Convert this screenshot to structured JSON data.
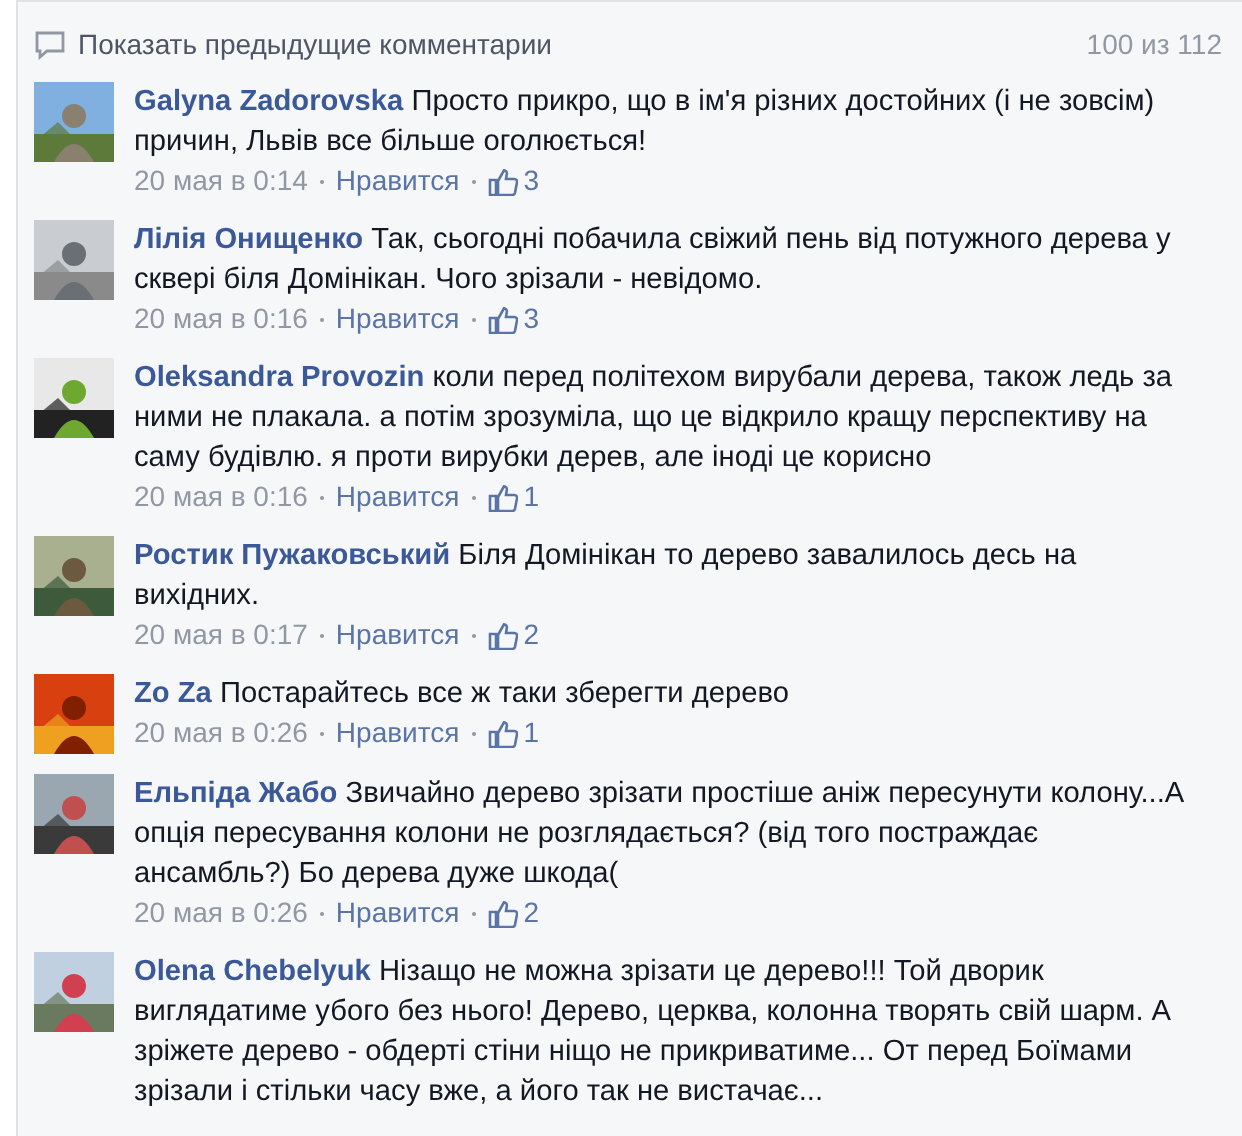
{
  "header": {
    "label": "Показать предыдущие комментарии",
    "count": "100 из 112"
  },
  "comments": [
    {
      "author": "Galyna Zadorovska",
      "text": "Просто прикро, що в ім'я різних достойних (і не зовсім) причин, Львів все більше оголюється!",
      "time": "20 мая в 0:14",
      "like": "Нравится",
      "likes": "3"
    },
    {
      "author": "Лілія Онищенко",
      "text": "Так, сьогодні побачила свіжий пень від потужного дерева у сквері біля Домінікан. Чого зрізали - невідомо.",
      "time": "20 мая в 0:16",
      "like": "Нравится",
      "likes": "3"
    },
    {
      "author": "Oleksandra Provozin",
      "text": "коли перед політехом вирубали дерева, також ледь за ними не плакала. а потім зрозуміла, що це відкрило кращу перспективу на саму будівлю. я проти вирубки дерев, але іноді це корисно",
      "time": "20 мая в 0:16",
      "like": "Нравится",
      "likes": "1"
    },
    {
      "author": "Ростик Пужаковський",
      "text": "Біля Домінікан то дерево завалилось десь на вихідних.",
      "time": "20 мая в 0:17",
      "like": "Нравится",
      "likes": "2"
    },
    {
      "author": "Zo Za",
      "text": "Постарайтесь все ж таки зберегти дерево",
      "time": "20 мая в 0:26",
      "like": "Нравится",
      "likes": "1"
    },
    {
      "author": "Ельпіда Жабо",
      "text": "Звичайно дерево зрізати простіше аніж пересунути колону...А опція пересування колони не розглядається? (від того постраждає ансамбль?) Бо дерева дуже шкода(",
      "time": "20 мая в 0:26",
      "like": "Нравится",
      "likes": "2"
    },
    {
      "author": "Olena Chebelyuk",
      "text": "Нізащо не можна зрізати це дерево!!! Той дворик виглядатиме убого без нього! Дерево, церква, колонна творять свій шарм. А зріжете дерево - обдерті стіни ніщо не прикриватиме... От перед Боїмами зрізали і стільки часу вже, а його так не вистачає..."
    }
  ]
}
